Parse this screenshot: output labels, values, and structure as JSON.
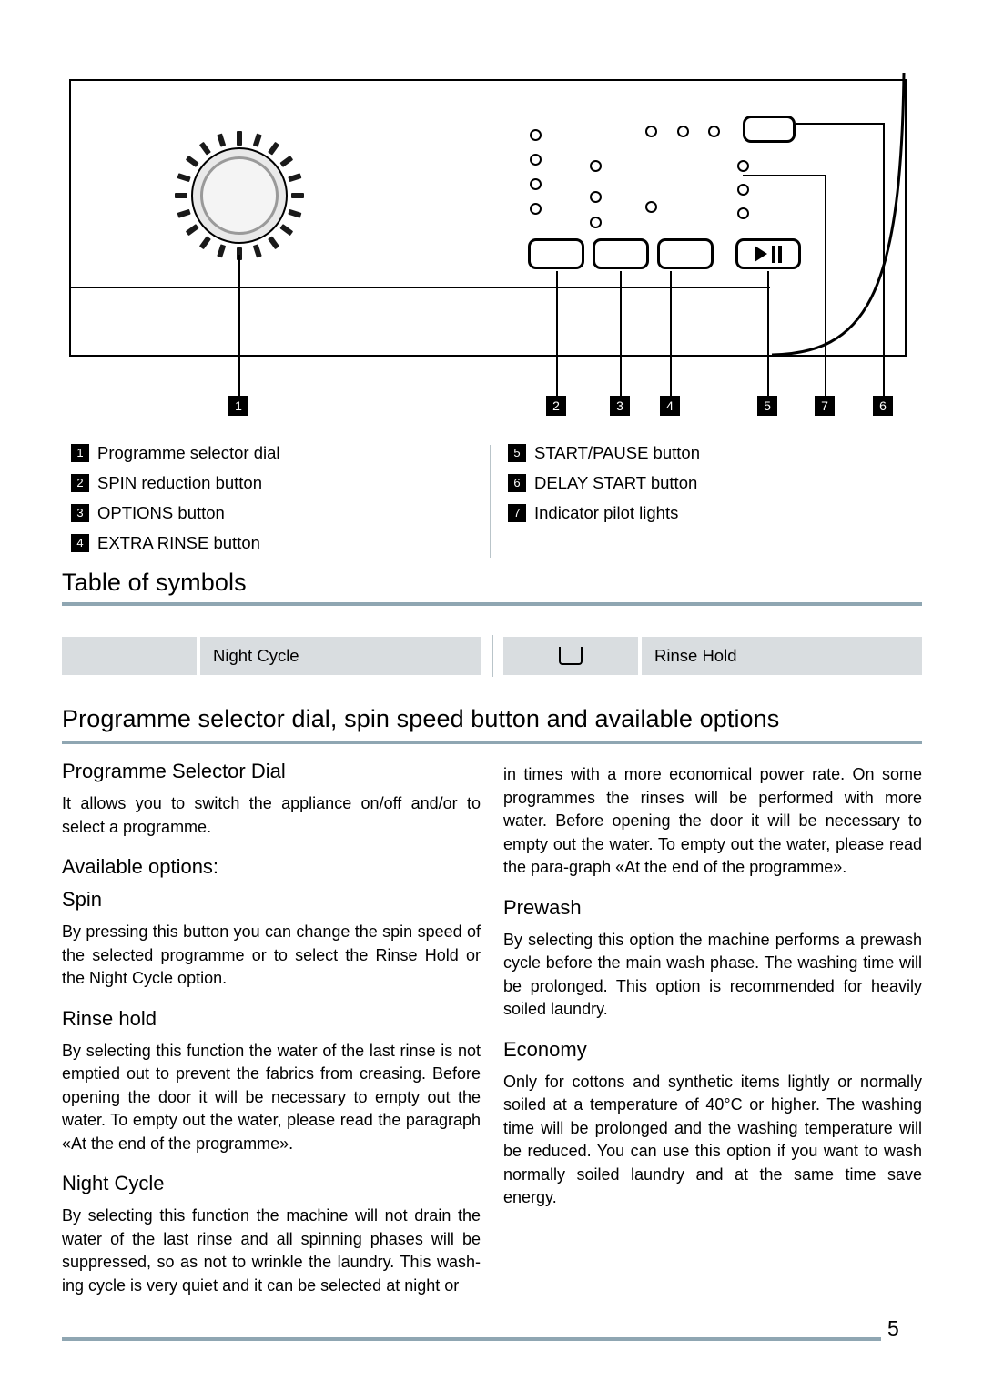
{
  "figure": {
    "caption_markers": [
      "1",
      "2",
      "3",
      "4",
      "5",
      "7",
      "6"
    ],
    "legend_left": [
      {
        "num": "1",
        "label": "Programme selector dial"
      },
      {
        "num": "2",
        "label": "SPIN reduction button"
      },
      {
        "num": "3",
        "label": "OPTIONS button"
      },
      {
        "num": "4",
        "label": "EXTRA RINSE button"
      }
    ],
    "legend_right": [
      {
        "num": "5",
        "label": "START/PAUSE button"
      },
      {
        "num": "6",
        "label": "DELAY START button"
      },
      {
        "num": "7",
        "label": "Indicator pilot lights"
      }
    ]
  },
  "sections": {
    "table_of_symbols_title": "Table of symbols",
    "programme_selector_title": "Programme selector dial, spin speed button and available options"
  },
  "symbols": [
    {
      "icon": "moon-icon",
      "label": "Night Cycle"
    },
    {
      "icon": "basin-icon",
      "label": "Rinse Hold"
    }
  ],
  "left_column": {
    "h_programme_selector_dial": "Programme Selector Dial",
    "p_programme_selector_dial": "It allows you to switch the appliance on/off and/or to select a programme.",
    "h_available_options": "Available options:",
    "h_spin": "Spin",
    "p_spin": "By pressing this button you can change the spin speed of the selected programme or to select the Rinse Hold or the Night Cycle option.",
    "h_rinse_hold": "Rinse hold",
    "p_rinse_hold": "By selecting this function the water of the last rinse is not emptied out to prevent the fabrics from creasing. Before opening the door it will be necessary to empty out the water. To empty out the water, please read the paragraph «At the end of the programme».",
    "h_night_cycle": "Night Cycle",
    "p_night_cycle": "By selecting this function the machine will not drain the water of the last rinse and all spinning phases will be suppressed, so as not to wrinkle the laundry. This wash-ing cycle is very quiet and it can be selected at night or"
  },
  "right_column": {
    "p_continued": "in times with a more economical power rate. On some programmes the rinses will be performed with more water. Before opening the door it will be necessary to empty out the water. To empty out the water, please read the para-graph «At the end of the programme».",
    "h_prewash": "Prewash",
    "p_prewash": "By selecting this option the machine performs a prewash cycle before the main wash phase. The washing time will be prolonged. This option is recommended for heavily soiled laundry.",
    "h_economy": "Economy",
    "p_economy": "Only for cottons and synthetic items lightly or normally soiled at a temperature of 40°C or higher. The washing time will be prolonged and the washing temperature will be reduced. You can use this option if you want to wash normally soiled laundry and at the same time save energy."
  },
  "footer": {
    "page_number": "5"
  },
  "colors": {
    "rule": "#8fa6b2",
    "symbol_cell": "#d9dde0",
    "ink": "#000000"
  }
}
